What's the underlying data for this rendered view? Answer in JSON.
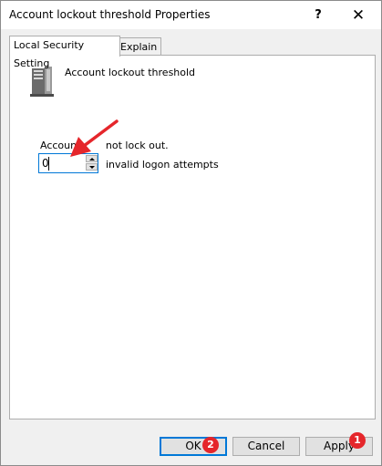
{
  "window": {
    "title": "Account lockout threshold Properties",
    "help_label": "?",
    "close_label": "✕"
  },
  "tabs": [
    {
      "label": "Local Security Setting",
      "active": true
    },
    {
      "label": "Explain",
      "active": false
    }
  ],
  "policy": {
    "icon": "server-policy-icon",
    "name": "Account lockout threshold"
  },
  "setting": {
    "description_left": "Account ",
    "description_right": "not lock out.",
    "value": "0",
    "suffix": "invalid logon attempts"
  },
  "buttons": {
    "ok": "OK",
    "cancel": "Cancel",
    "apply": "Apply"
  },
  "annotations": {
    "badge_ok": "2",
    "badge_apply": "1",
    "arrow_color": "#e5262b"
  }
}
